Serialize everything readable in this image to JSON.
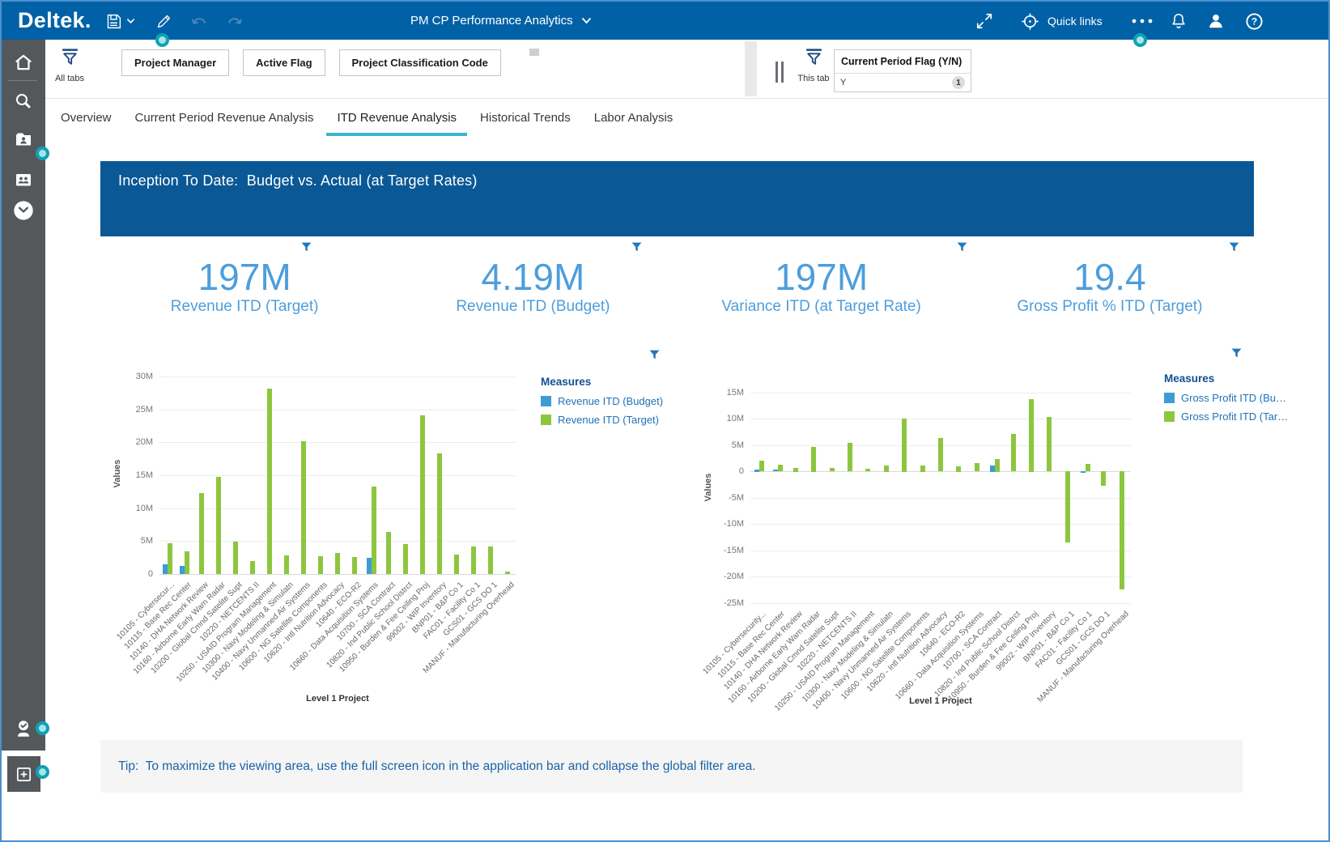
{
  "app": {
    "logo": "Deltek.",
    "title": "PM CP Performance Analytics",
    "quick_links_label": "Quick links"
  },
  "filters": {
    "all_tabs_label": "All tabs",
    "this_tab_label": "This tab",
    "global_filters": [
      "Project Manager",
      "Active Flag",
      "Project Classification Code"
    ],
    "tab_filter": {
      "title": "Current Period Flag (Y/N)",
      "value": "Y",
      "count": "1"
    }
  },
  "tabs": {
    "items": [
      "Overview",
      "Current Period Revenue Analysis",
      "ITD Revenue Analysis",
      "Historical Trends",
      "Labor Analysis"
    ],
    "active": "ITD Revenue Analysis"
  },
  "banner": {
    "title": "Inception To Date:  Budget vs. Actual (at Target Rates)"
  },
  "kpis": [
    {
      "value": "197M",
      "label": "Revenue ITD (Target)"
    },
    {
      "value": "4.19M",
      "label": "Revenue ITD (Budget)"
    },
    {
      "value": "197M",
      "label": "Variance ITD (at Target Rate)"
    },
    {
      "value": "19.4",
      "label": "Gross Profit % ITD (Target)"
    }
  ],
  "chart_data": [
    {
      "type": "bar",
      "title": "",
      "xlabel": "Level 1 Project",
      "ylabel": "Values",
      "values_unit": "millions",
      "ylim": [
        0,
        30
      ],
      "grid": true,
      "legend_title": "Measures",
      "legend_position": "right",
      "yticks": [
        {
          "v": 0,
          "label": "0"
        },
        {
          "v": 5,
          "label": "5M"
        },
        {
          "v": 10,
          "label": "10M"
        },
        {
          "v": 15,
          "label": "15M"
        },
        {
          "v": 20,
          "label": "20M"
        },
        {
          "v": 25,
          "label": "25M"
        },
        {
          "v": 30,
          "label": "30M"
        }
      ],
      "categories": [
        "10105 - Cybersecur...",
        "10115 - Base Rec Center",
        "10140 - DHA Network Review",
        "10160 - Airborne Early Warn Radar",
        "10200 - Global Cmnd Satelite Supt",
        "10220 - NETCENTS II",
        "10250 - USAID Program Management",
        "10300 - Navy Modeling & Simulatn",
        "10400 - Navy Unmanned Air Systems",
        "10600 - NG Satellite Components",
        "10620 - Intl Nutrition Advocacy",
        "10640 - ECO-R2",
        "10660 - Data Acquisition Systems",
        "10700 - SCA Contract",
        "10820 - Ind Public School Distrct",
        "10950 - Burden & Fee Ceiling Proj",
        "99002 - WIP Inventory",
        "BNP01 - B&P Co 1",
        "FAC01 - Facility Co 1",
        "GCS01 - GCS DO 1",
        "MANUF - Manufacturing Overhead"
      ],
      "series": [
        {
          "name": "Revenue ITD (Budget)",
          "color": "#3D9BD5",
          "values": [
            1.5,
            1.2,
            0,
            0,
            0,
            0,
            0,
            0,
            0,
            0,
            0,
            0,
            2.5,
            0,
            0,
            0,
            0,
            0,
            0,
            0,
            0
          ]
        },
        {
          "name": "Revenue ITD (Target)",
          "color": "#8CC63F",
          "values": [
            4.7,
            3.4,
            12.3,
            14.8,
            4.9,
            2.0,
            28.2,
            2.8,
            20.2,
            2.7,
            3.2,
            2.6,
            13.3,
            6.4,
            4.5,
            24.1,
            18.3,
            2.9,
            4.2,
            4.2,
            0.4
          ]
        }
      ]
    },
    {
      "type": "bar",
      "title": "",
      "xlabel": "Level 1 Project",
      "ylabel": "Values",
      "values_unit": "millions",
      "ylim": [
        -25,
        18.5
      ],
      "grid": true,
      "legend_title": "Measures",
      "legend_position": "right",
      "yticks": [
        {
          "v": 15,
          "label": "15M"
        },
        {
          "v": 10,
          "label": "10M"
        },
        {
          "v": 5,
          "label": "5M"
        },
        {
          "v": 0,
          "label": "0"
        },
        {
          "v": -5,
          "label": "-5M"
        },
        {
          "v": -10,
          "label": "-10M"
        },
        {
          "v": -15,
          "label": "-15M"
        },
        {
          "v": -20,
          "label": "-20M"
        },
        {
          "v": -25,
          "label": "-25M"
        }
      ],
      "categories": [
        "10105 - Cybersecurity...",
        "10115 - Base Rec Center",
        "10140 - DHA Network Review",
        "10160 - Airborne Early Warn Radar",
        "10200 - Global Cmnd Satelite Supt",
        "10220 - NETCENTS II",
        "10250 - USAID Program Management",
        "10300 - Navy Modeling & Simulatn",
        "10400 - Navy Unmanned Air Systems",
        "10600 - NG Satellite Components",
        "10620 - Intl Nutrition Advocacy",
        "10640 - ECO-R2",
        "10660 - Data Acquisition Systems",
        "10700 - SCA Contract",
        "10820 - Ind Public School Distrct",
        "10950 - Burden & Fee Ceiling Proj",
        "99002 - WIP Inventory",
        "BNP01 - B&P Co 1",
        "FAC01 - Facility Co 1",
        "GCS01 - GCS DO 1",
        "MANUF - Manufacturing Overhead"
      ],
      "series": [
        {
          "name": "Gross Profit ITD (Bu…",
          "color": "#3D9BD5",
          "values": [
            0.4,
            0.3,
            0,
            0,
            0,
            0,
            0,
            0,
            0,
            0,
            0,
            0,
            0,
            1.2,
            0,
            0,
            0,
            0,
            -0.3,
            0,
            0
          ]
        },
        {
          "name": "Gross Profit ITD (Tar…",
          "color": "#8CC63F",
          "values": [
            2.0,
            1.3,
            0.7,
            4.7,
            0.6,
            5.4,
            0.5,
            1.2,
            10.1,
            1.2,
            6.3,
            1.0,
            1.6,
            2.4,
            7.1,
            13.8,
            10.3,
            -13.5,
            1.4,
            -2.8,
            -22.5
          ]
        }
      ]
    }
  ],
  "tip": {
    "text": "Tip:  To maximize the viewing area, use the full screen icon in the application bar and collapse the global filter area."
  },
  "colors": {
    "header": "#0061A6",
    "banner": "#0A5896",
    "kpi_text": "#4D9EDB",
    "accent_teal": "#3AB7C8",
    "bar_blue": "#3D9BD5",
    "bar_green": "#8CC63F",
    "hotspot_teal": "#0FA2B4",
    "sidebar": "#54585B"
  }
}
